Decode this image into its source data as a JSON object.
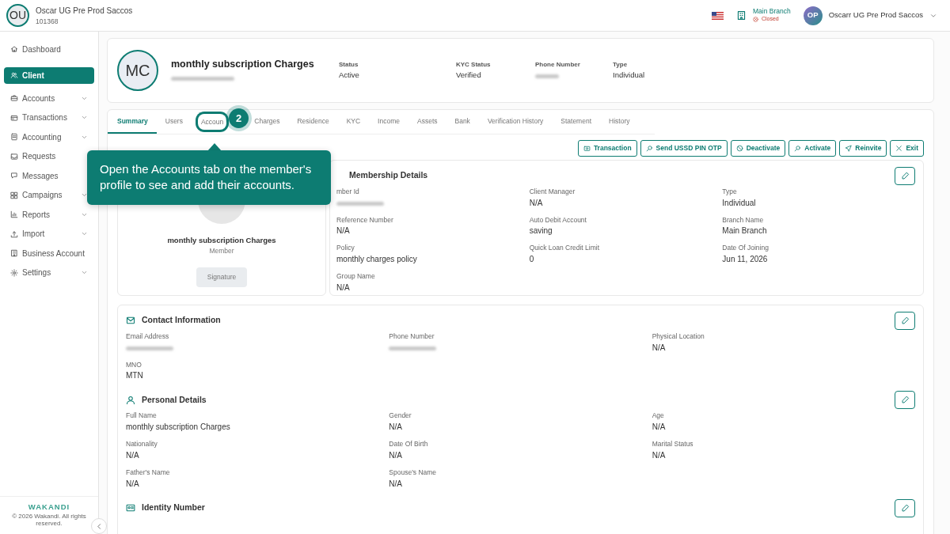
{
  "org": {
    "initials": "OU",
    "name": "Oscar UG Pre Prod Saccos",
    "code": "101368"
  },
  "topbar": {
    "branch": "Main Branch",
    "branch_status": "Closed",
    "user_initials": "OP",
    "user_name": "Oscarr UG Pre Prod Saccos"
  },
  "sidebar": {
    "items": [
      {
        "label": "Dashboard",
        "selected": false,
        "expandable": false
      },
      {
        "label": "Client",
        "selected": true,
        "expandable": false
      },
      {
        "label": "Accounts",
        "selected": false,
        "expandable": true
      },
      {
        "label": "Transactions",
        "selected": false,
        "expandable": true
      },
      {
        "label": "Accounting",
        "selected": false,
        "expandable": true
      },
      {
        "label": "Requests",
        "selected": false,
        "expandable": false
      },
      {
        "label": "Messages",
        "selected": false,
        "expandable": false
      },
      {
        "label": "Campaigns",
        "selected": false,
        "expandable": true
      },
      {
        "label": "Reports",
        "selected": false,
        "expandable": true
      },
      {
        "label": "Import",
        "selected": false,
        "expandable": true
      },
      {
        "label": "Business Account",
        "selected": false,
        "expandable": false
      },
      {
        "label": "Settings",
        "selected": false,
        "expandable": true
      }
    ],
    "brand": "WAKANDI",
    "copyright": "© 2026 Wakandi. All rights reserved."
  },
  "profile": {
    "initials": "MC",
    "name": "monthly subscription Charges",
    "subtitle_blurred": true,
    "stats": [
      {
        "label": "Status",
        "value": "Active"
      },
      {
        "label": "KYC Status",
        "value": "Verified"
      },
      {
        "label": "Phone Number",
        "blurred": true
      },
      {
        "label": "Type",
        "value": "Individual"
      }
    ]
  },
  "tabs": [
    {
      "label": "Summary",
      "selected": true
    },
    {
      "label": "Users",
      "selected": false
    },
    {
      "label": "Accoun",
      "selected": false,
      "highlighted": true
    },
    {
      "label": "Charges",
      "selected": false
    },
    {
      "label": "Residence",
      "selected": false
    },
    {
      "label": "KYC",
      "selected": false
    },
    {
      "label": "Income",
      "selected": false
    },
    {
      "label": "Assets",
      "selected": false
    },
    {
      "label": "Bank",
      "selected": false
    },
    {
      "label": "Verification History",
      "selected": false
    },
    {
      "label": "Statement",
      "selected": false
    },
    {
      "label": "History",
      "selected": false
    }
  ],
  "actions": [
    "Transaction",
    "Send USSD PIN OTP",
    "Deactivate",
    "Activate",
    "Reinvite",
    "Exit"
  ],
  "member_card": {
    "name": "monthly subscription Charges",
    "role": "Member",
    "signature_button": "Signature"
  },
  "membership": {
    "title": "Membership Details",
    "fields": [
      {
        "label": "mber Id",
        "blurred": true
      },
      {
        "label": "Client Manager",
        "value": "N/A"
      },
      {
        "label": "Type",
        "value": "Individual"
      },
      {
        "label": "Reference Number",
        "value": "N/A"
      },
      {
        "label": "Auto Debit Account",
        "value": "saving"
      },
      {
        "label": "Branch Name",
        "value": "Main Branch"
      },
      {
        "label": "Policy",
        "value": "monthly charges policy"
      },
      {
        "label": "Quick Loan Credit Limit",
        "value": "0"
      },
      {
        "label": "Date Of Joining",
        "value": "Jun 11, 2026"
      },
      {
        "label": "Group Name",
        "value": "N/A"
      }
    ]
  },
  "sections": [
    {
      "title": "Contact Information",
      "fields": [
        {
          "label": "Email Address",
          "blurred": true
        },
        {
          "label": "Phone Number",
          "blurred": true
        },
        {
          "label": "Physical Location",
          "value": "N/A"
        },
        {
          "label": "MNO",
          "value": "MTN"
        }
      ]
    },
    {
      "title": "Personal Details",
      "fields": [
        {
          "label": "Full Name",
          "value": "monthly subscription Charges"
        },
        {
          "label": "Gender",
          "value": "N/A"
        },
        {
          "label": "Age",
          "value": "N/A"
        },
        {
          "label": "Nationality",
          "value": "N/A"
        },
        {
          "label": "Date Of Birth",
          "value": "N/A"
        },
        {
          "label": "Marital Status",
          "value": "N/A"
        },
        {
          "label": "Father's Name",
          "value": "N/A"
        },
        {
          "label": "Spouse's Name",
          "value": "N/A"
        }
      ]
    },
    {
      "title": "Identity Number"
    }
  ],
  "tour": {
    "step": "2",
    "text": "Open the Accounts tab on the member's profile to see and add their accounts."
  }
}
